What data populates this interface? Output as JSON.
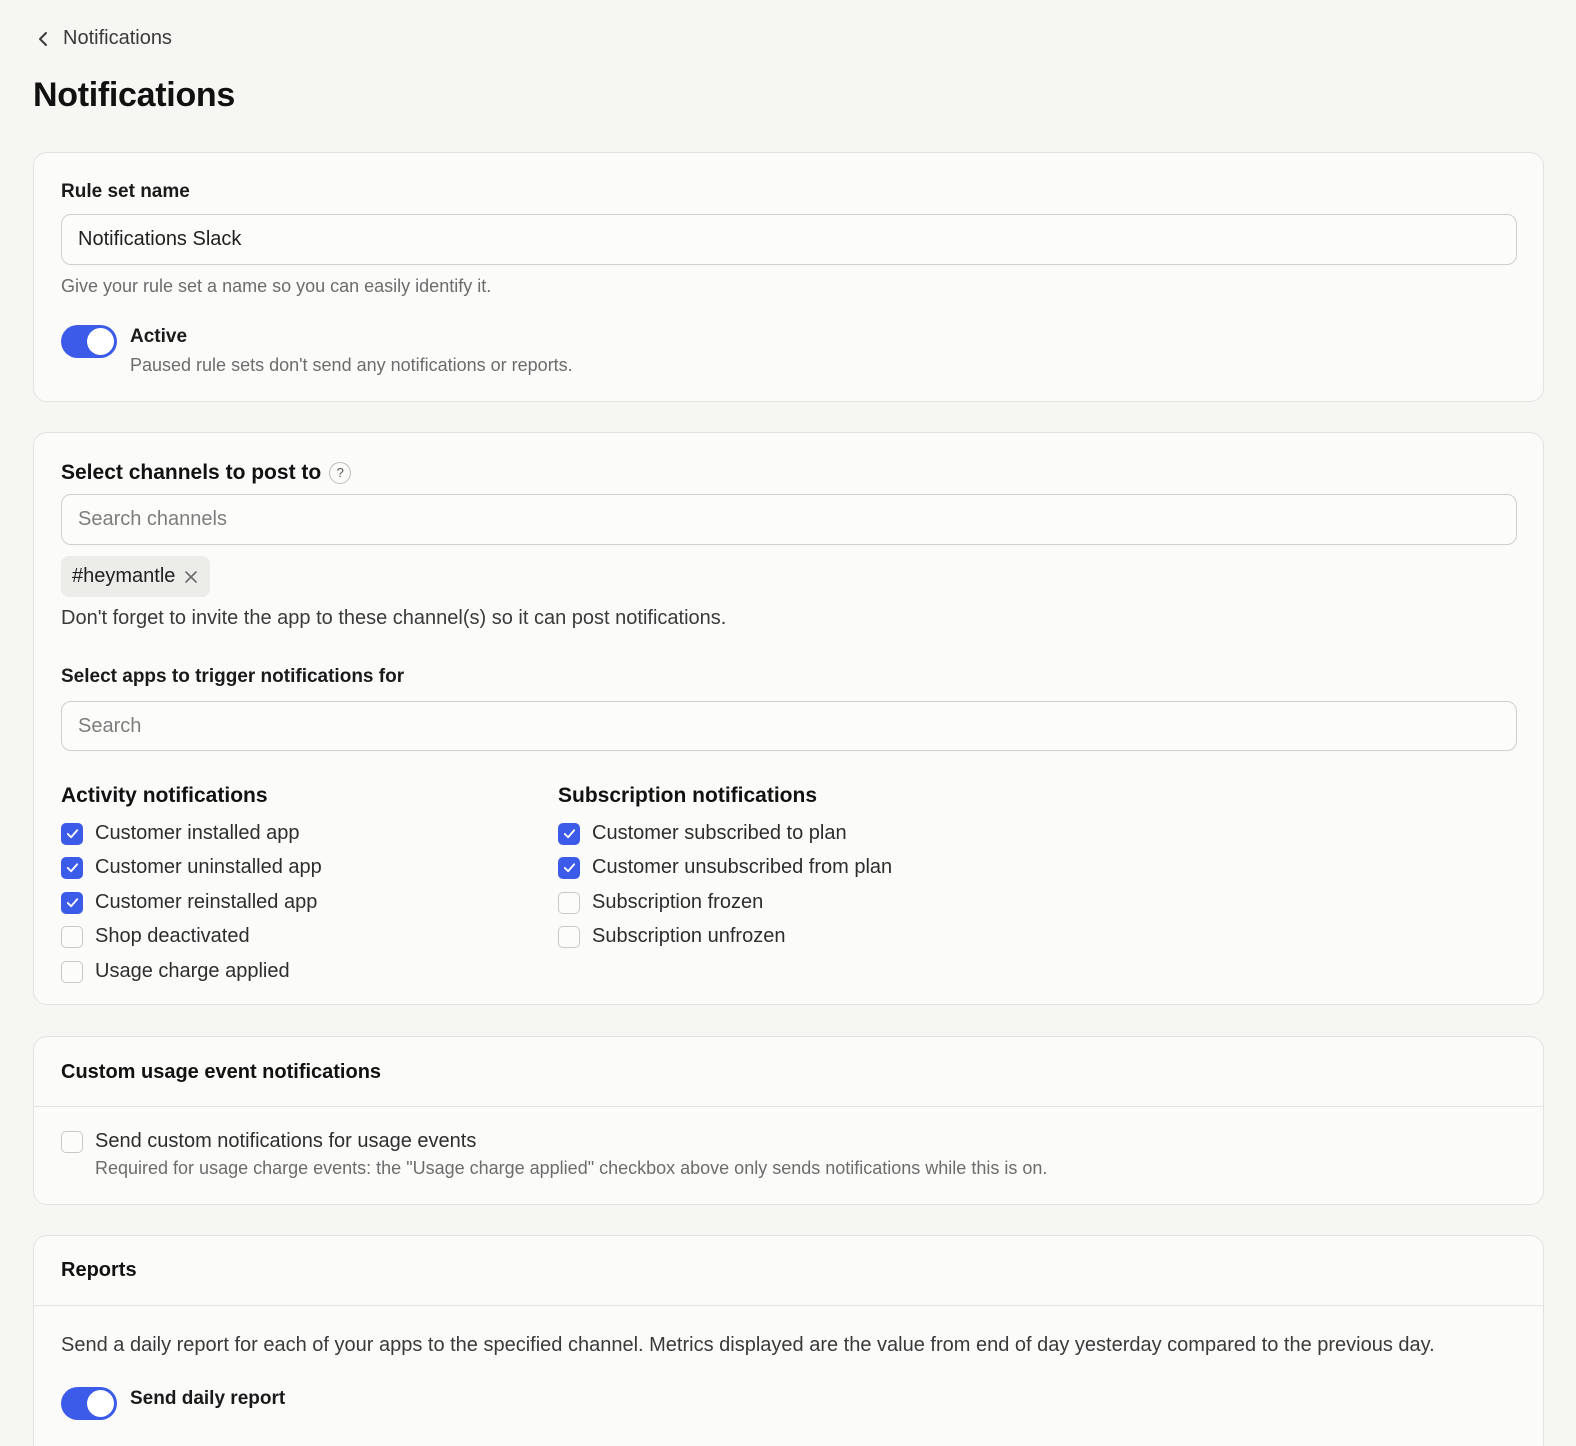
{
  "breadcrumb": {
    "label": "Notifications",
    "icon": "chevron-left-icon"
  },
  "page": {
    "title": "Notifications"
  },
  "rule_set": {
    "label": "Rule set name",
    "value": "Notifications Slack",
    "help": "Give your rule set a name so you can easily identify it.",
    "active": {
      "label": "Active",
      "help": "Paused rule sets don't send any notifications or reports.",
      "on": true
    }
  },
  "channels": {
    "label": "Select channels to post to",
    "help_icon": "?",
    "search_placeholder": "Search channels",
    "selected": [
      {
        "name": "#heymantle"
      }
    ],
    "note": "Don't forget to invite the app to these channel(s) so it can post notifications.",
    "apps_label": "Select apps to trigger notifications for",
    "apps_placeholder": "Search"
  },
  "activity": {
    "title": "Activity notifications",
    "items": [
      {
        "label": "Customer installed app",
        "checked": true
      },
      {
        "label": "Customer uninstalled app",
        "checked": true
      },
      {
        "label": "Customer reinstalled app",
        "checked": true
      },
      {
        "label": "Shop deactivated",
        "checked": false
      },
      {
        "label": "Usage charge applied",
        "checked": false
      }
    ]
  },
  "subscription": {
    "title": "Subscription notifications",
    "items": [
      {
        "label": "Customer subscribed to plan",
        "checked": true
      },
      {
        "label": "Customer unsubscribed from plan",
        "checked": true
      },
      {
        "label": "Subscription frozen",
        "checked": false
      },
      {
        "label": "Subscription unfrozen",
        "checked": false
      }
    ]
  },
  "custom_usage": {
    "title": "Custom usage event notifications",
    "option": {
      "label": "Send custom notifications for usage events",
      "help": "Required for usage charge events: the \"Usage charge applied\" checkbox above only sends notifications while this is on.",
      "checked": false
    }
  },
  "reports": {
    "title": "Reports",
    "description": "Send a daily report for each of your apps to the specified channel. Metrics displayed are the value from end of day yesterday compared to the previous day.",
    "daily": {
      "label": "Send daily report",
      "on": true
    }
  },
  "colors": {
    "accent": "#3b5be8",
    "background": "#f6f6f3",
    "card": "#fbfbfa"
  }
}
